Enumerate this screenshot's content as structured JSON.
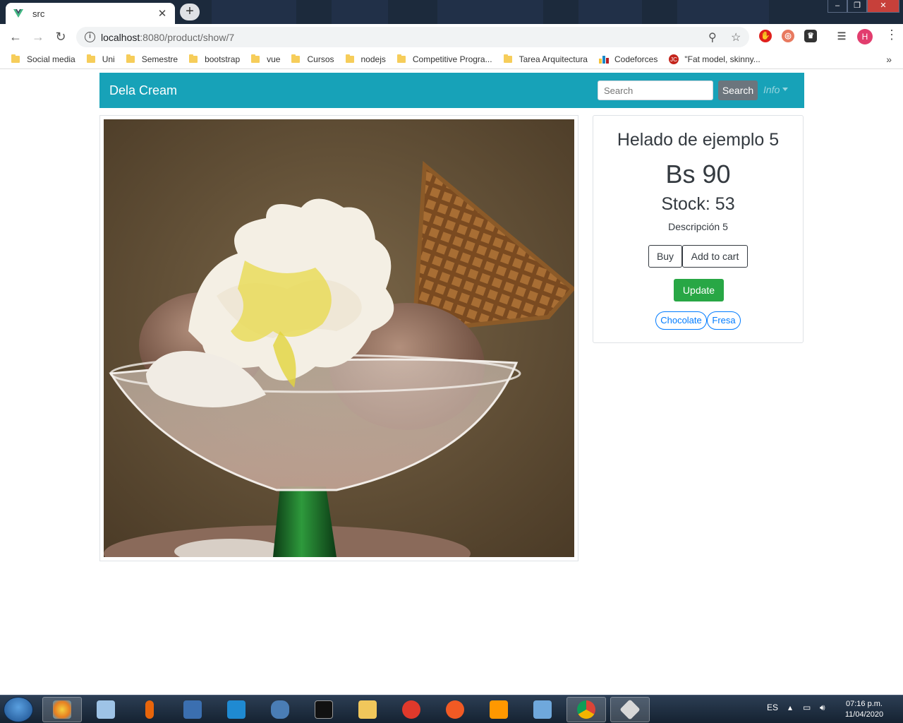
{
  "browser": {
    "tab_title": "src",
    "new_tab_label": "+",
    "url_host": "localhost",
    "url_rest": ":8080/product/show/7",
    "avatar_letter": "H",
    "bookmarks": [
      {
        "label": "Social media",
        "icon": "folder-icon"
      },
      {
        "label": "Uni",
        "icon": "folder-icon"
      },
      {
        "label": "Semestre",
        "icon": "folder-icon"
      },
      {
        "label": "bootstrap",
        "icon": "folder-icon"
      },
      {
        "label": "vue",
        "icon": "folder-icon"
      },
      {
        "label": "Cursos",
        "icon": "folder-icon"
      },
      {
        "label": "nodejs",
        "icon": "folder-icon"
      },
      {
        "label": "Competitive Progra...",
        "icon": "folder-icon"
      },
      {
        "label": "Tarea Arquitectura",
        "icon": "folder-icon"
      },
      {
        "label": "Codeforces",
        "icon": "codeforces-icon"
      },
      {
        "label": "\"Fat model, skinny...",
        "icon": "site-icon"
      }
    ],
    "bookmarks_more": "»"
  },
  "navbar": {
    "brand": "Dela Cream",
    "search_placeholder": "Search",
    "search_button": "Search",
    "info_menu": "Info"
  },
  "product": {
    "name": "Helado de ejemplo 5",
    "price": "Bs 90",
    "stock": "Stock: 53",
    "description": "Descripción 5",
    "buy_label": "Buy",
    "add_to_cart_label": "Add to cart",
    "update_label": "Update",
    "tags": [
      "Chocolate",
      "Fresa"
    ]
  },
  "taskbar": {
    "language": "ES",
    "time": "07:16 p.m.",
    "date": "11/04/2020"
  },
  "colors": {
    "navbar": "#17a2b8",
    "update_button": "#28a745",
    "tag": "#007bff"
  }
}
